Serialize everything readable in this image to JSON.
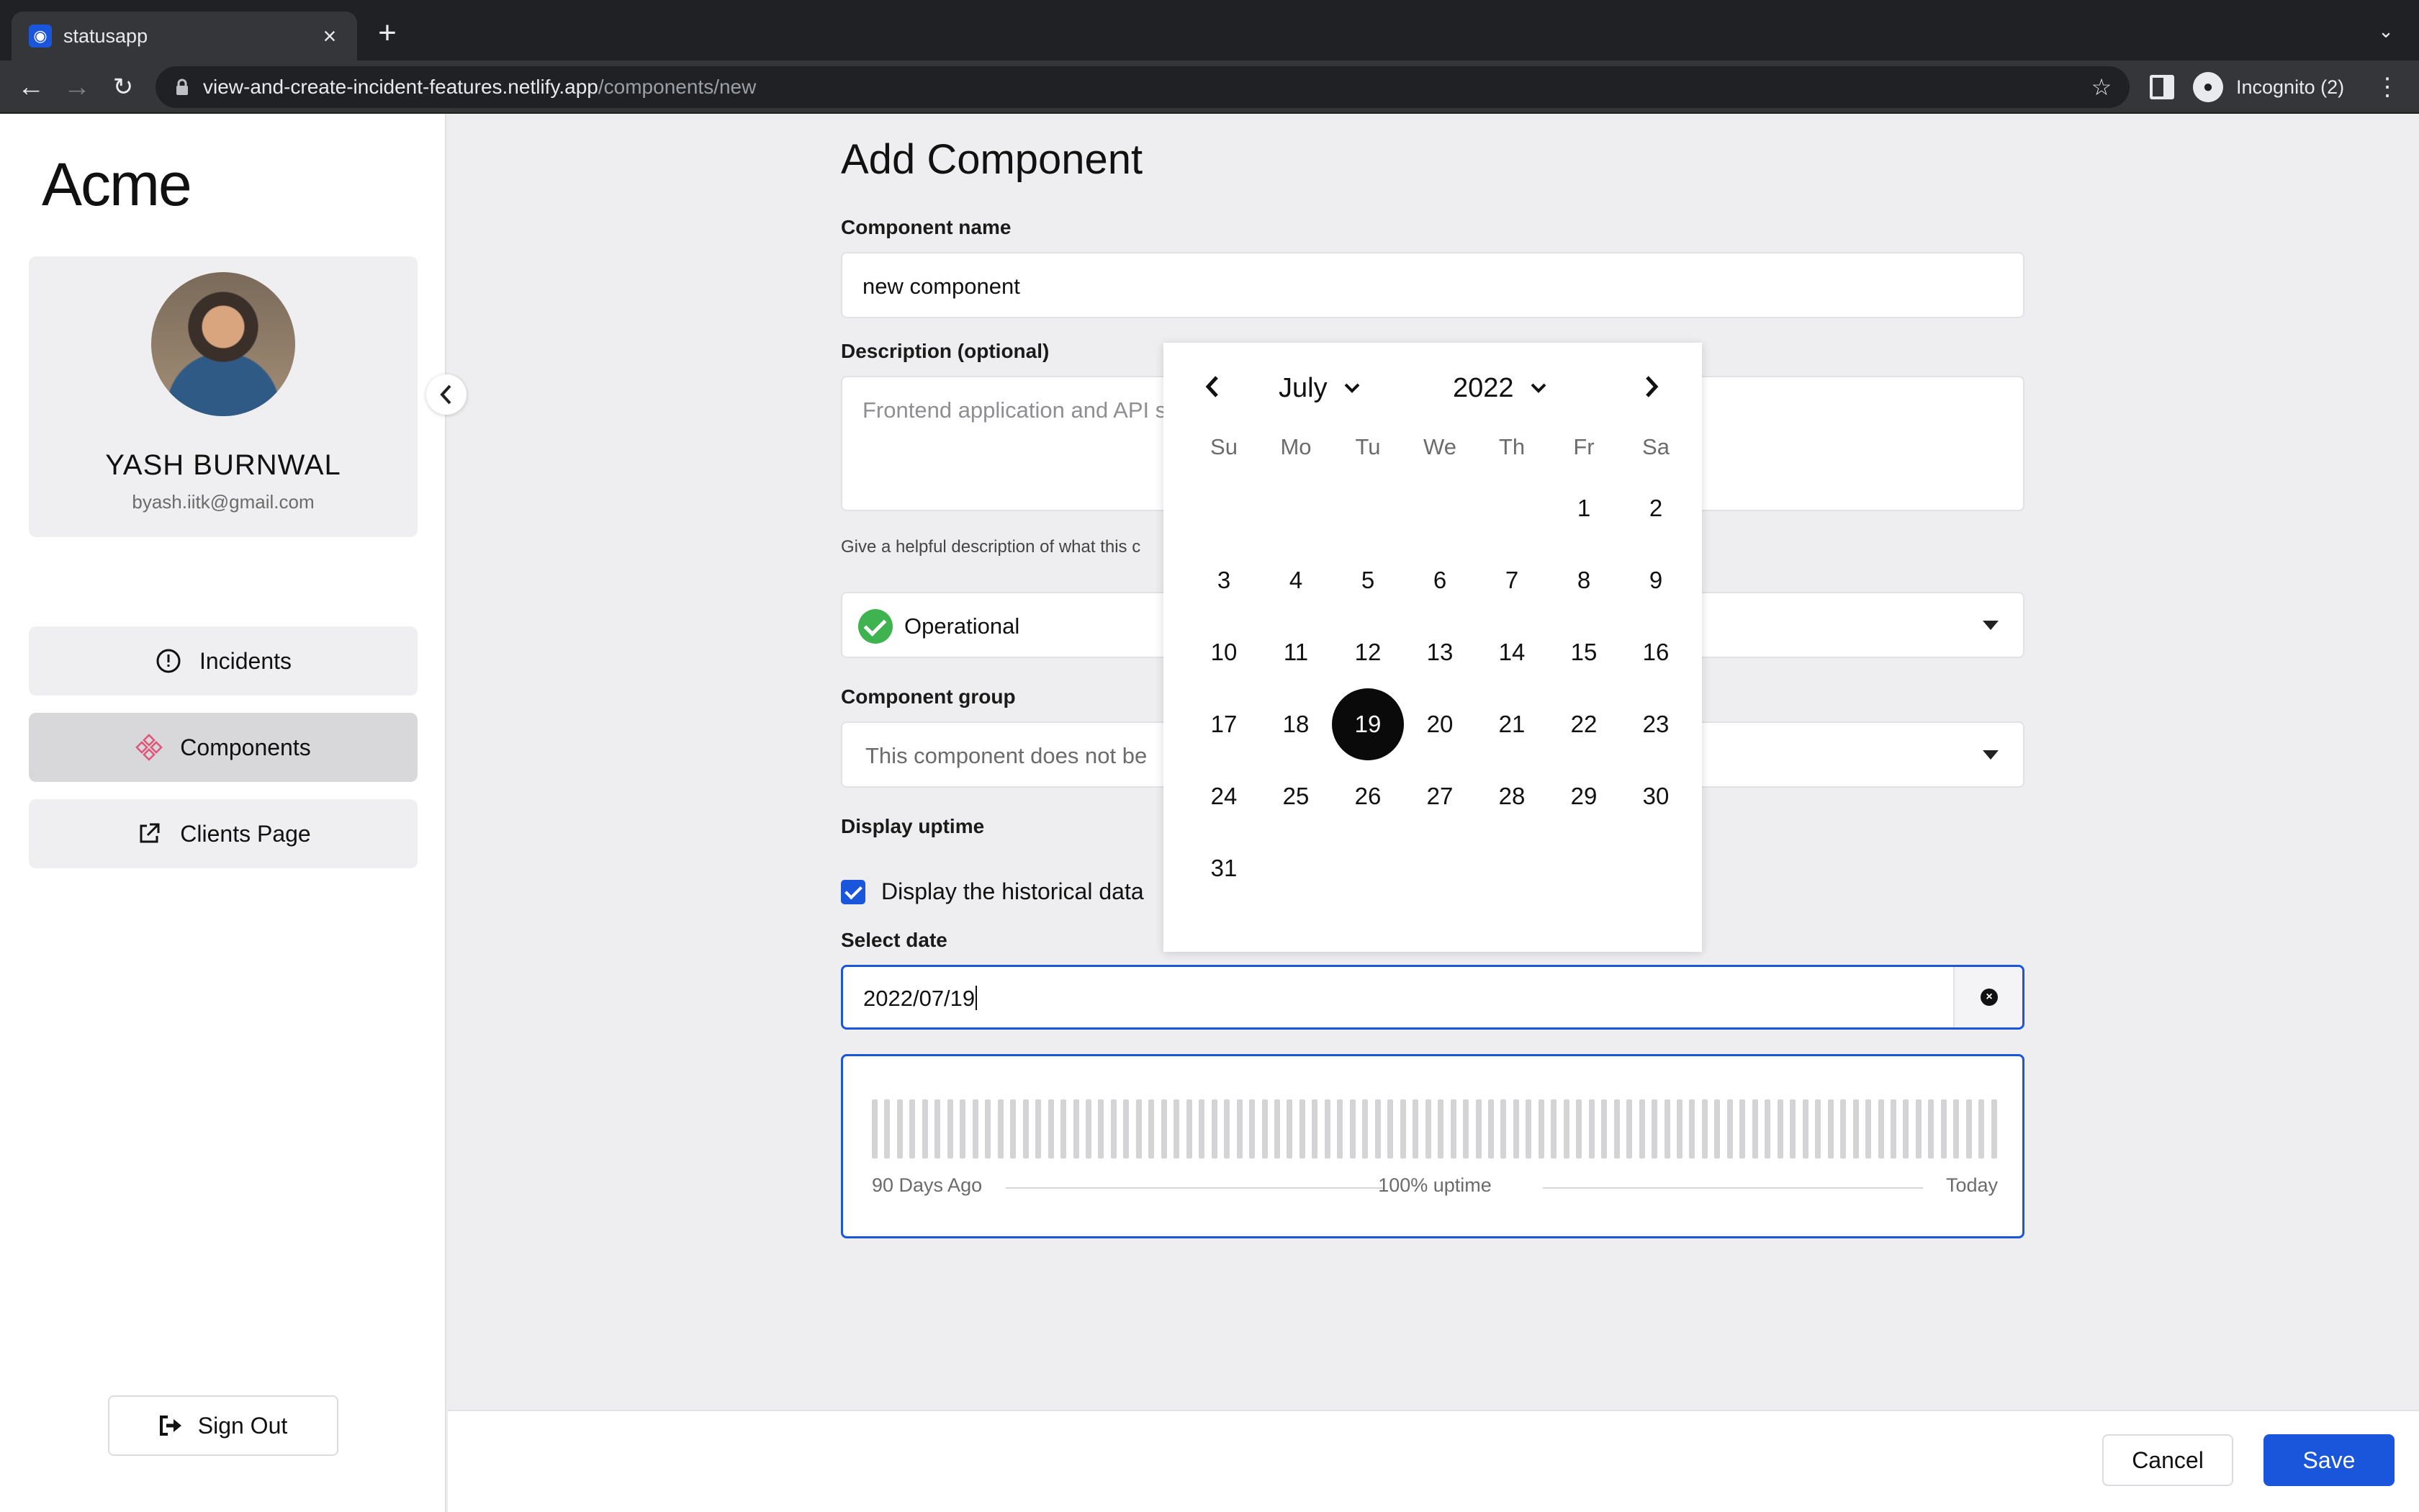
{
  "browser": {
    "tab_title": "statusapp",
    "url_host": "view-and-create-incident-features.netlify.app",
    "url_path": "/components/new",
    "profile_label": "Incognito (2)"
  },
  "sidebar": {
    "brand": "Acme",
    "user_name": "YASH BURNWAL",
    "user_email": "byash.iitk@gmail.com",
    "nav": [
      {
        "label": "Incidents",
        "icon": "alert-circle-icon"
      },
      {
        "label": "Components",
        "icon": "components-icon",
        "active": true
      },
      {
        "label": "Clients Page",
        "icon": "external-link-icon"
      }
    ],
    "sign_out": "Sign Out"
  },
  "form": {
    "title": "Add Component",
    "name_label": "Component name",
    "name_value": "new component",
    "description_label": "Description (optional)",
    "description_placeholder": "Frontend application and API s",
    "description_helper": "Give a helpful description of what this c",
    "status_value": "Operational",
    "group_label": "Component group",
    "group_placeholder": "This component does not be",
    "uptime_label": "Display uptime",
    "historical_checkbox_label": "Display the historical data",
    "historical_checked": true,
    "select_date_label": "Select date",
    "date_value": "2022/07/19",
    "uptime_left": "90 Days Ago",
    "uptime_center": "100% uptime",
    "uptime_right": "Today",
    "uptime_bar_count": 90
  },
  "calendar": {
    "month": "July",
    "year": "2022",
    "weekdays": [
      "Su",
      "Mo",
      "Tu",
      "We",
      "Th",
      "Fr",
      "Sa"
    ],
    "weeks": [
      [
        "",
        "",
        "",
        "",
        "",
        "1",
        "2"
      ],
      [
        "3",
        "4",
        "5",
        "6",
        "7",
        "8",
        "9"
      ],
      [
        "10",
        "11",
        "12",
        "13",
        "14",
        "15",
        "16"
      ],
      [
        "17",
        "18",
        "19",
        "20",
        "21",
        "22",
        "23"
      ],
      [
        "24",
        "25",
        "26",
        "27",
        "28",
        "29",
        "30"
      ],
      [
        "31",
        "",
        "",
        "",
        "",
        "",
        ""
      ]
    ],
    "selected_day": "19"
  },
  "footer": {
    "cancel": "Cancel",
    "save": "Save"
  },
  "colors": {
    "primary": "#1a56db",
    "operational": "#3eb34f",
    "components_icon": "#e0567a"
  }
}
